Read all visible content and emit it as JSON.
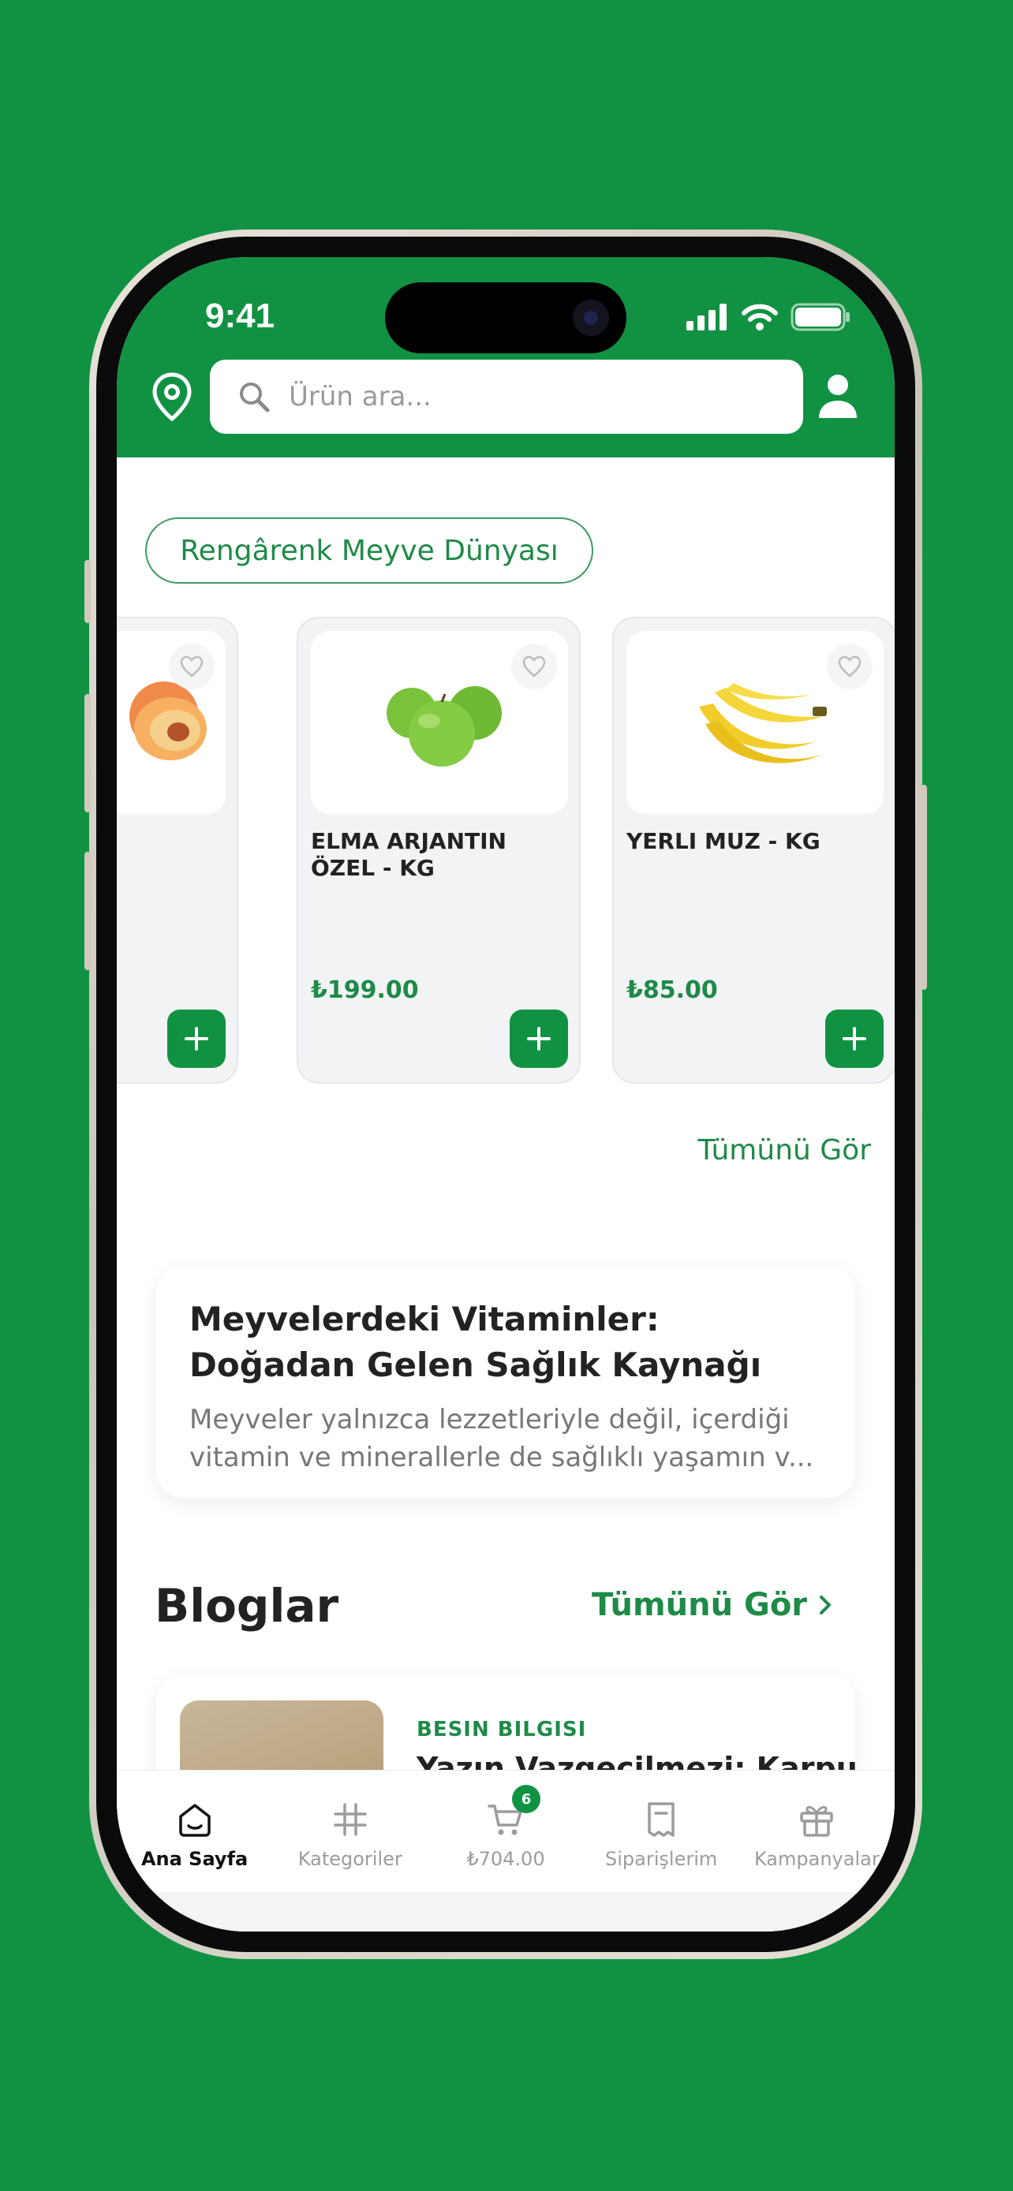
{
  "status_bar": {
    "time": "9:41"
  },
  "search": {
    "placeholder": "Ürün ara..."
  },
  "category_chip": {
    "label": "Rengârenk Meyve Dünyası"
  },
  "products": [
    {
      "name": "",
      "price": "",
      "image": "peach"
    },
    {
      "name": "ELMA ARJANTIN ÖZEL - KG",
      "price": "₺199.00",
      "image": "green-apples"
    },
    {
      "name": "YERLI MUZ - KG",
      "price": "₺85.00",
      "image": "bananas"
    }
  ],
  "products_see_all": "Tümünü Gör",
  "article": {
    "title": "Meyvelerdeki Vitaminler: Doğadan Gelen Sağlık Kaynağı",
    "description": "Meyveler yalnızca lezzetleriyle değil, içerdiği vitamin ve minerallerle de sağlıklı yaşamın v..."
  },
  "blogs": {
    "title": "Bloglar",
    "see_all": "Tümünü Gör",
    "items": [
      {
        "category": "BESIN BILGISI",
        "title": "Yazın Vazgeçilmezi: Karpuz"
      }
    ]
  },
  "tabbar": {
    "items": [
      {
        "label": "Ana Sayfa",
        "icon": "home-icon",
        "active": true
      },
      {
        "label": "Kategoriler",
        "icon": "hash-icon",
        "active": false
      },
      {
        "label": "₺704.00",
        "icon": "cart-icon",
        "active": false,
        "badge": "6"
      },
      {
        "label": "Siparişlerim",
        "icon": "receipt-icon",
        "active": false
      },
      {
        "label": "Kampanyalar",
        "icon": "gift-icon",
        "active": false
      }
    ]
  },
  "colors": {
    "brand_green": "#119243",
    "accent_text": "#1e8a47"
  }
}
